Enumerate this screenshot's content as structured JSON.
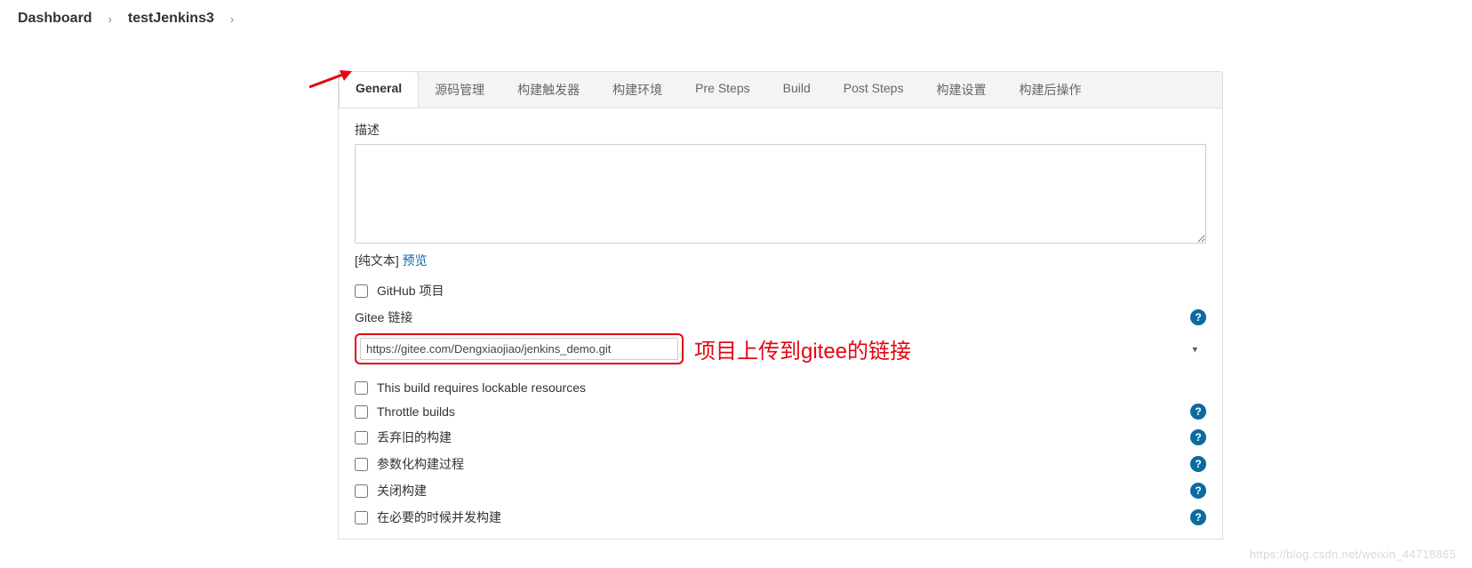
{
  "breadcrumb": {
    "items": [
      "Dashboard",
      "testJenkins3"
    ]
  },
  "tabs": [
    {
      "label": "General",
      "active": true
    },
    {
      "label": "源码管理",
      "active": false
    },
    {
      "label": "构建触发器",
      "active": false
    },
    {
      "label": "构建环境",
      "active": false
    },
    {
      "label": "Pre Steps",
      "active": false
    },
    {
      "label": "Build",
      "active": false
    },
    {
      "label": "Post Steps",
      "active": false
    },
    {
      "label": "构建设置",
      "active": false
    },
    {
      "label": "构建后操作",
      "active": false
    }
  ],
  "form": {
    "description_label": "描述",
    "description_value": "",
    "format_plain_prefix": "[纯文本]",
    "format_preview_link": "预览",
    "github_project_label": "GitHub 项目",
    "gitee_label": "Gitee 链接",
    "gitee_value": "https://gitee.com/Dengxiaojiao/jenkins_demo.git",
    "gitee_annotation": "项目上传到gitee的链接",
    "options": [
      {
        "label": "This build requires lockable resources",
        "help": false
      },
      {
        "label": "Throttle builds",
        "help": true
      },
      {
        "label": "丢弃旧的构建",
        "help": true
      },
      {
        "label": "参数化构建过程",
        "help": true
      },
      {
        "label": "关闭构建",
        "help": true
      },
      {
        "label": "在必要的时候并发构建",
        "help": true
      }
    ]
  },
  "help_glyph": "?",
  "watermark": "https://blog.csdn.net/weixin_44718865"
}
